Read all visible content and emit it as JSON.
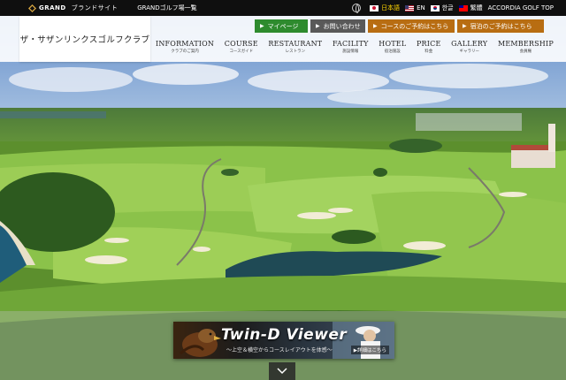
{
  "topbar": {
    "brand": "GRAND",
    "brand_sub": "ブランドサイト",
    "link_list": "GRANDゴルフ場一覧",
    "languages": [
      {
        "label": "日本語",
        "flag": "flag-jp",
        "current": true
      },
      {
        "label": "EN",
        "flag": "flag-us",
        "current": false
      },
      {
        "label": "한글",
        "flag": "flag-kr",
        "current": false
      },
      {
        "label": "繁體",
        "flag": "flag-tw",
        "current": false
      }
    ],
    "accordia": "ACCORDIA GOLF TOP"
  },
  "header": {
    "logo_text": "ザ・サザンリンクスゴルフクラブ",
    "cta": {
      "mypage": "マイページ",
      "contact": "お問い合わせ",
      "course_reserve": "コースのご予約はこちら",
      "hotel_reserve": "宿泊のご予約はこちら"
    },
    "nav": [
      {
        "en": "INFORMATION",
        "jp": "クラブのご案内"
      },
      {
        "en": "COURSE",
        "jp": "コースガイド"
      },
      {
        "en": "RESTAURANT",
        "jp": "レストラン"
      },
      {
        "en": "FACILITY",
        "jp": "施設情報"
      },
      {
        "en": "HOTEL",
        "jp": "宿泊施設"
      },
      {
        "en": "PRICE",
        "jp": "料金"
      },
      {
        "en": "GALLERY",
        "jp": "ギャラリー"
      },
      {
        "en": "MEMBERSHIP",
        "jp": "会員権"
      }
    ]
  },
  "banner": {
    "title": "Twin-D Viewer",
    "subtitle": "〜上空＆横空からコースレイアウトを体感〜",
    "button": "▶詳細はこちら"
  },
  "colors": {
    "green_cta": "#2e8b2e",
    "gray_cta": "#595959",
    "orange_cta": "#b86d12",
    "selected_lang": "#ffd400"
  }
}
